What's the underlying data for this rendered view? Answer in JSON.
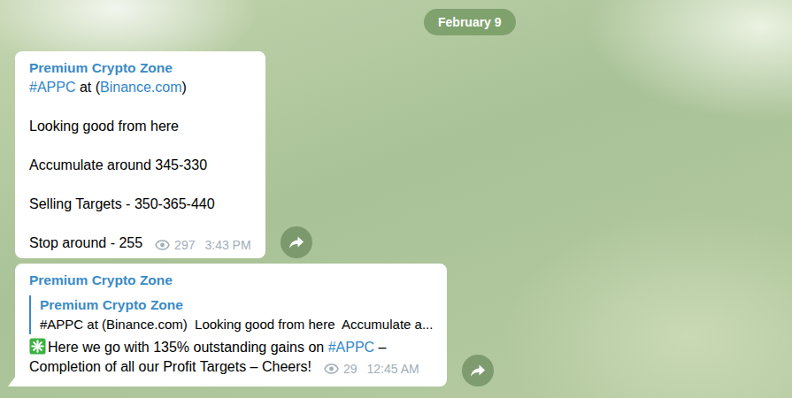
{
  "date": "February 9",
  "messages": [
    {
      "kind": "post",
      "sender": "Premium Crypto Zone",
      "paragraphs": [
        [
          {
            "text": "#APPC",
            "link": true
          },
          {
            "text": " at (",
            "link": false
          },
          {
            "text": "Binance.com",
            "link": true
          },
          {
            "text": ")",
            "link": false
          }
        ],
        [
          {
            "text": "Looking good from here",
            "link": false
          }
        ],
        [
          {
            "text": "Accumulate around 345-330",
            "link": false
          }
        ],
        [
          {
            "text": "Selling Targets - 350-365-440",
            "link": false
          }
        ],
        [
          {
            "text": "Stop around - 255",
            "link": false
          }
        ]
      ],
      "views": "297",
      "time": "3:43 PM"
    },
    {
      "kind": "reply",
      "sender": "Premium Crypto Zone",
      "reply": {
        "sender": "Premium Crypto Zone",
        "text": "#APPC at (Binance.com)  Looking good from here  Accumulate a..."
      },
      "paragraphs": [
        [
          {
            "text": "Here we go with 135% outstanding gains on ",
            "link": false
          },
          {
            "text": "#APPC",
            "link": true
          },
          {
            "text": " –",
            "link": false
          }
        ],
        [
          {
            "text": "Completion of all our Profit Targets – Cheers!",
            "link": false
          }
        ]
      ],
      "views": "29",
      "time": "12:45 AM"
    }
  ]
}
